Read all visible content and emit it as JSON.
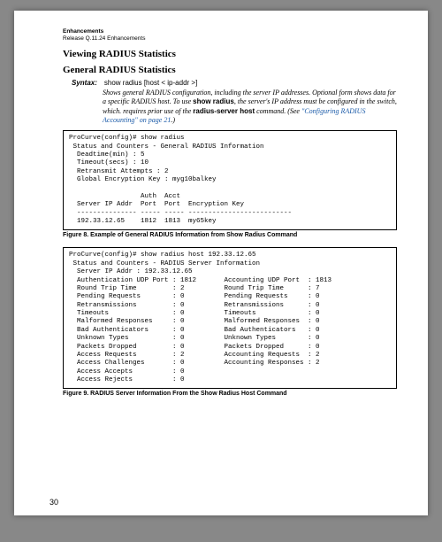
{
  "header": {
    "title": "Enhancements",
    "subtitle": "Release Q.11.24 Enhancements"
  },
  "sections": {
    "h1": "Viewing RADIUS Statistics",
    "h2": "General RADIUS Statistics"
  },
  "syntax": {
    "label": "Syntax:",
    "command": "show radius [host < ip-addr >]",
    "desc_part1": "Shows general RADIUS configuration, including the server IP addresses. Optional form shows data for a specific RADIUS host. To use ",
    "desc_bold1": "show radius",
    "desc_part2": ", the server's IP address must be configured in the switch, which. requires prior use of the ",
    "desc_bold2": "radius-server host",
    "desc_part3": " command. (See ",
    "desc_link": "\"Configuring RADIUS Accounting\" on page 21",
    "desc_part4": ".)"
  },
  "codebox1": "ProCurve(config)# show radius\n Status and Counters - General RADIUS Information\n  Deadtime(min) : 5\n  Timeout(secs) : 10\n  Retransmit Attempts : 2\n  Global Encryption Key : myg10balkey\n\n                  Auth  Acct\n  Server IP Addr  Port  Port  Encryption Key\n  --------------- ----- ----- --------------------------\n  192.33.12.65    1812  1813  my65key",
  "caption1": "Figure 8.  Example of General RADIUS Information from Show Radius Command",
  "codebox2": "ProCurve(config)# show radius host 192.33.12.65\n Status and Counters - RADIUS Server Information\n  Server IP Addr : 192.33.12.65\n  Authentication UDP Port : 1812       Accounting UDP Port  : 1813\n  Round Trip Time         : 2          Round Trip Time      : 7\n  Pending Requests        : 0          Pending Requests     : 0\n  Retransmissions         : 0          Retransmissions      : 0\n  Timeouts                : 0          Timeouts             : 0\n  Malformed Responses     : 0          Malformed Responses  : 0\n  Bad Authenticators      : 0          Bad Authenticators   : 0\n  Unknown Types           : 0          Unknown Types        : 0\n  Packets Dropped         : 0          Packets Dropped      : 0\n  Access Requests         : 2          Accounting Requests  : 2\n  Access Challenges       : 0          Accounting Responses : 2\n  Access Accepts          : 0\n  Access Rejects          : 0",
  "caption2": "Figure 9.  RADIUS Server Information From the Show Radius Host Command",
  "page_number": "30"
}
